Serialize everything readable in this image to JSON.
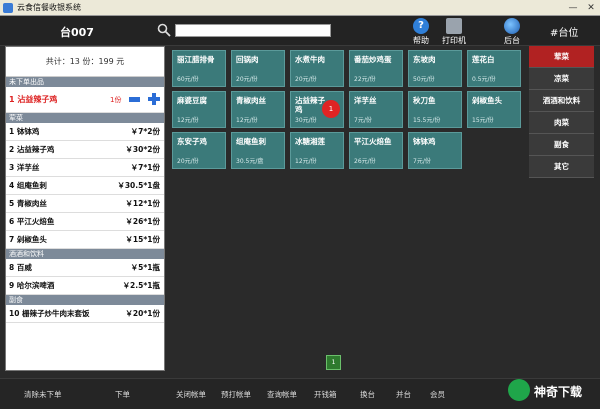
{
  "window": {
    "title": "云食信餐收银系统"
  },
  "header": {
    "table_name": "台007",
    "search_placeholder": "",
    "tools": [
      {
        "label": "帮助",
        "icon": "help-icon"
      },
      {
        "label": "打印机",
        "icon": "printer-icon"
      },
      {
        "label": "后台",
        "icon": "globe-icon"
      }
    ],
    "seat_label": "#台位"
  },
  "left_panel": {
    "summary": "共计：13 份：199 元",
    "unsent": {
      "header": "未下单出品",
      "item": {
        "name": "1 沾益辣子鸡",
        "qty": "1份"
      }
    },
    "groups": [
      {
        "header": "荤菜",
        "rows": [
          {
            "name": "1 钵钵鸡",
            "price": "￥7*2份"
          },
          {
            "name": "2 沾益辣子鸡",
            "price": "￥30*2份"
          },
          {
            "name": "3 洋芋丝",
            "price": "￥7*1份"
          },
          {
            "name": "4 组庵鱼刺",
            "price": "￥30.5*1盘"
          },
          {
            "name": "5 青椒肉丝",
            "price": "￥12*1份"
          },
          {
            "name": "6 平江火焙鱼",
            "price": "￥26*1份"
          },
          {
            "name": "7 剁椒鱼头",
            "price": "￥15*1份"
          }
        ]
      },
      {
        "header": "酒酒和饮料",
        "rows": [
          {
            "name": "8 百威",
            "price": "￥5*1瓶"
          },
          {
            "name": "9 哈尔滨啤酒",
            "price": "￥2.5*1瓶"
          }
        ]
      },
      {
        "header": "副食",
        "rows": [
          {
            "name": "10 栅辣子炒牛肉末套饭",
            "price": "￥20*1份"
          }
        ]
      }
    ]
  },
  "menu": {
    "tiles": [
      {
        "name": "丽江腊排骨",
        "price": "60元/份"
      },
      {
        "name": "回锅肉",
        "price": "20元/份"
      },
      {
        "name": "水煮牛肉",
        "price": "20元/份"
      },
      {
        "name": "番茄炒鸡蛋",
        "price": "22元/份"
      },
      {
        "name": "东坡肉",
        "price": "50元/份"
      },
      {
        "name": "莲花白",
        "price": "0.5元/份"
      },
      {
        "name": "麻婆豆腐",
        "price": "12元/份"
      },
      {
        "name": "青椒肉丝",
        "price": "12元/份"
      },
      {
        "name": "沾益辣子鸡",
        "price": "30元/份",
        "badge": "1"
      },
      {
        "name": "洋芋丝",
        "price": "7元/份"
      },
      {
        "name": "秋刀鱼",
        "price": "15.5元/份"
      },
      {
        "name": "剁椒鱼头",
        "price": "15元/份"
      },
      {
        "name": "东安子鸡",
        "price": "20元/份"
      },
      {
        "name": "组庵鱼刺",
        "price": "30.5元/盘"
      },
      {
        "name": "冰糖湘莲",
        "price": "12元/份"
      },
      {
        "name": "平江火焙鱼",
        "price": "26元/份"
      },
      {
        "name": "钵钵鸡",
        "price": "7元/份"
      }
    ],
    "page": "1"
  },
  "categories": [
    {
      "label": "荤菜",
      "active": true
    },
    {
      "label": "凉菜"
    },
    {
      "label": "酒酒和饮料"
    },
    {
      "label": "肉菜"
    },
    {
      "label": "副食"
    },
    {
      "label": "其它"
    }
  ],
  "bottom_bar": {
    "buttons": [
      "清除未下单",
      "下单",
      "关闭帐单",
      "预打帐单",
      "查询帐单",
      "开钱箱",
      "换台",
      "并台",
      "会员"
    ]
  },
  "brand": {
    "text": "神奇下载"
  },
  "colors": {
    "tile": "#3b7a7a",
    "active_category": "#b12222",
    "badge": "#e02424"
  }
}
